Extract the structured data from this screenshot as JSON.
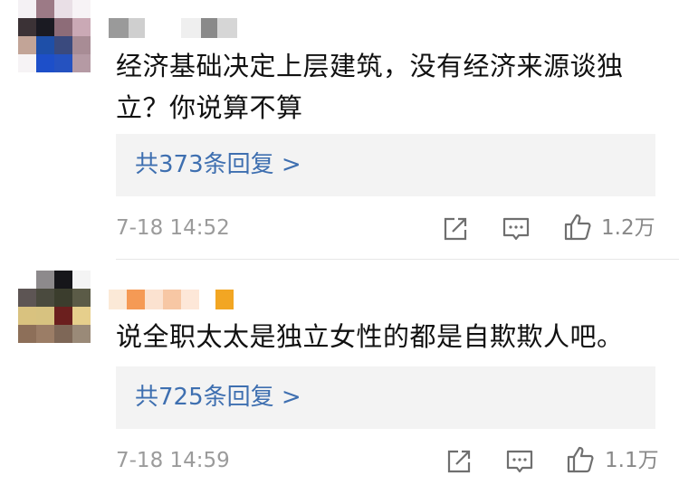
{
  "comments": [
    {
      "text": "经济基础决定上层建筑，没有经济来源谈独立？你说算不算",
      "replies_label": "共373条回复 >",
      "time": "7-18 14:52",
      "likes": "1.2万",
      "icons": [
        "share-icon",
        "comment-icon",
        "thumbs-up-icon"
      ]
    },
    {
      "text": "说全职太太是独立女性的都是自欺欺人吧。",
      "replies_label": "共725条回复 >",
      "time": "7-18 14:59",
      "likes": "1.1万",
      "icons": [
        "share-icon",
        "comment-icon",
        "thumbs-up-icon"
      ]
    }
  ],
  "colors": {
    "link": "#3e6fb0",
    "meta": "#9b9b9b",
    "reply_bg": "#f3f3f3"
  }
}
